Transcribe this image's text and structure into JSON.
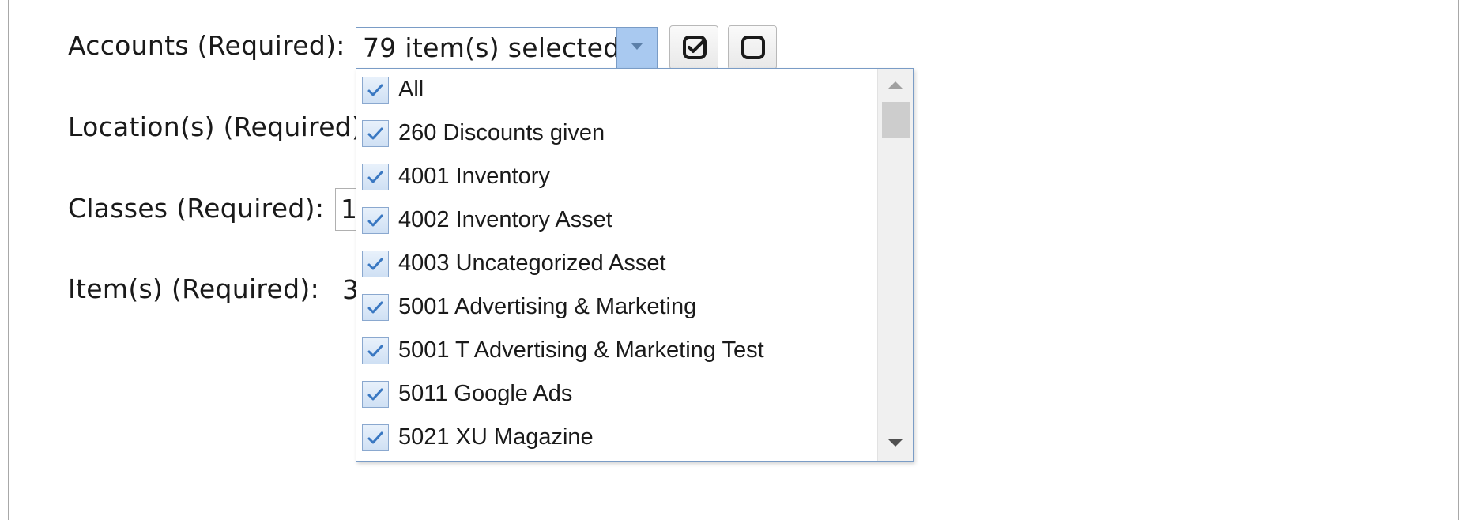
{
  "form": {
    "accounts_label": "Accounts (Required):",
    "locations_label": "Location(s) (Required):",
    "classes_label": "Classes (Required):",
    "items_label": "Item(s) (Required):",
    "classes_value_stub": "1",
    "items_value_stub": "3"
  },
  "accounts_select": {
    "selected_text": "79 item(s) selected",
    "check_all_icon": "check-square-icon",
    "clear_all_icon": "empty-square-icon"
  },
  "dropdown": {
    "items": [
      {
        "label": "All",
        "checked": true
      },
      {
        "label": "260 Discounts given",
        "checked": true
      },
      {
        "label": "4001 Inventory",
        "checked": true
      },
      {
        "label": "4002 Inventory Asset",
        "checked": true
      },
      {
        "label": "4003 Uncategorized Asset",
        "checked": true
      },
      {
        "label": "5001 Advertising & Marketing",
        "checked": true
      },
      {
        "label": "5001 T Advertising & Marketing Test",
        "checked": true
      },
      {
        "label": "5011 Google Ads",
        "checked": true
      },
      {
        "label": "5021 XU Magazine",
        "checked": true
      }
    ]
  },
  "colors": {
    "accent_border": "#7a9cc6",
    "arrow_bg": "#a9c9f0",
    "checkbox_check": "#3a78c2"
  }
}
